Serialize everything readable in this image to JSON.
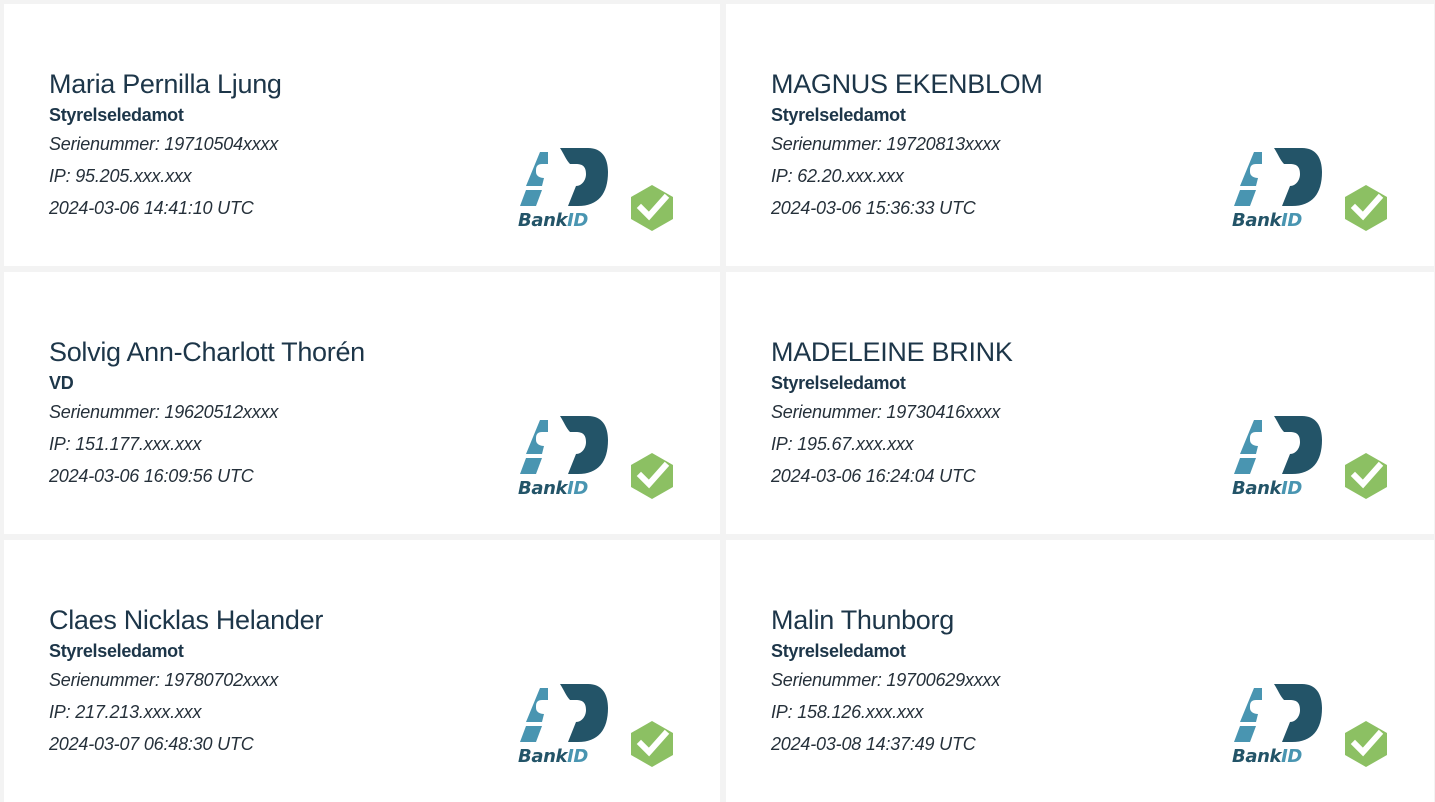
{
  "signers": [
    {
      "name": "Maria Pernilla Ljung",
      "role": "Styrelseledamot",
      "serial": "Serienummer: 19710504xxxx",
      "ip": "IP: 95.205.xxx.xxx",
      "timestamp": "2024-03-06 14:41:10 UTC"
    },
    {
      "name": "MAGNUS EKENBLOM",
      "role": "Styrelseledamot",
      "serial": "Serienummer: 19720813xxxx",
      "ip": "IP: 62.20.xxx.xxx",
      "timestamp": "2024-03-06 15:36:33 UTC"
    },
    {
      "name": "Solvig Ann-Charlott Thorén",
      "role": "VD",
      "serial": "Serienummer: 19620512xxxx",
      "ip": "IP: 151.177.xxx.xxx",
      "timestamp": "2024-03-06 16:09:56 UTC"
    },
    {
      "name": "MADELEINE BRINK",
      "role": "Styrelseledamot",
      "serial": "Serienummer: 19730416xxxx",
      "ip": "IP: 195.67.xxx.xxx",
      "timestamp": "2024-03-06 16:24:04 UTC"
    },
    {
      "name": "Claes Nicklas Helander",
      "role": "Styrelseledamot",
      "serial": "Serienummer: 19780702xxxx",
      "ip": "IP: 217.213.xxx.xxx",
      "timestamp": "2024-03-07 06:48:30 UTC"
    },
    {
      "name": "Malin Thunborg",
      "role": "Styrelseledamot",
      "serial": "Serienummer: 19700629xxxx",
      "ip": "IP: 158.126.xxx.xxx",
      "timestamp": "2024-03-08 14:37:49 UTC"
    }
  ],
  "logo": {
    "text_bank": "Bank",
    "text_id": "ID",
    "icon": "bankid-logo"
  },
  "status_icon": "verified-check-icon",
  "colors": {
    "text": "#1d3649",
    "bankid_dark": "#235468",
    "bankid_light": "#4995b1",
    "check_green": "#8cc063",
    "background": "#f3f3f3"
  }
}
